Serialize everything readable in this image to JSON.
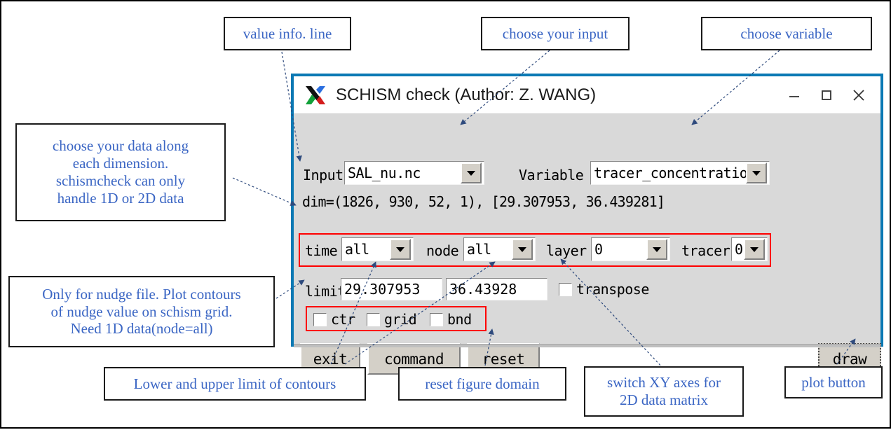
{
  "window": {
    "title": "SCHISM check (Author: Z. WANG)",
    "logo_icon": "x11-logo-icon",
    "border_color": "#0b79b4",
    "controls": {
      "minimize": "minimize-icon",
      "maximize": "maximize-icon",
      "close": "close-icon"
    }
  },
  "form": {
    "input_label": "Input",
    "input_value": "SAL_nu.nc",
    "variable_label": "Variable",
    "variable_value": "tracer_concentration",
    "info_line": "dim=(1826, 930, 52, 1), [29.307953, 36.439281]",
    "dims": [
      {
        "label": "time",
        "value": "all"
      },
      {
        "label": "node",
        "value": "all"
      },
      {
        "label": "layer",
        "value": "0"
      },
      {
        "label": "tracer",
        "value": "0"
      }
    ],
    "limit_label": "limit",
    "limit_lower": "29.307953",
    "limit_upper": "36.43928",
    "transpose_label": "transpose",
    "transpose_checked": false,
    "checkboxes": [
      {
        "label": "ctr",
        "checked": false
      },
      {
        "label": "grid",
        "checked": false
      },
      {
        "label": "bnd",
        "checked": false
      }
    ],
    "buttons": {
      "exit": "exit",
      "command": "command",
      "reset": "reset",
      "draw": "draw"
    }
  },
  "annotations": {
    "value_info": "value info. line",
    "choose_input": "choose your input",
    "choose_variable": "choose variable",
    "choose_dims": [
      "choose your data along",
      "each dimension.",
      "schismcheck can only",
      "handle 1D or 2D data"
    ],
    "nudge": [
      "Only for nudge file. Plot contours",
      "of nudge value on schism grid.",
      "Need 1D data(node=all)"
    ],
    "limits": "Lower and upper limit of contours",
    "reset_domain": "reset figure domain",
    "switch_xy": [
      "switch XY axes for",
      "2D data matrix"
    ],
    "plot_button": "plot button"
  },
  "colors": {
    "annotation_text": "#3b66c4",
    "annotation_border": "#1a1a1a",
    "highlight_box": "#ff0000",
    "dialog_bg": "#d9d9d9",
    "leader_line": "#2e4a7d"
  }
}
